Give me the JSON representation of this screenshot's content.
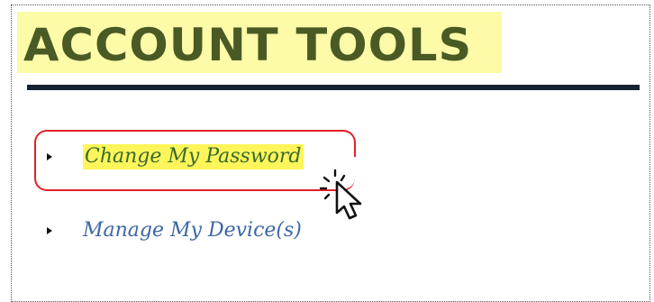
{
  "page": {
    "title": "ACCOUNT TOOLS"
  },
  "menu": {
    "items": [
      {
        "label": "Change My Password",
        "highlighted": true
      },
      {
        "label": "Manage My Device(s)",
        "highlighted": false
      }
    ]
  },
  "icons": {
    "bullet": "caret-right-icon",
    "cursor": "click-cursor-icon"
  },
  "colors": {
    "title_text": "#4a5a24",
    "title_highlight": "#fdfaa8",
    "rule": "#152233",
    "link": "#3d67a7",
    "link_highlight": "#fdf55a",
    "callout": "#e0212a"
  }
}
